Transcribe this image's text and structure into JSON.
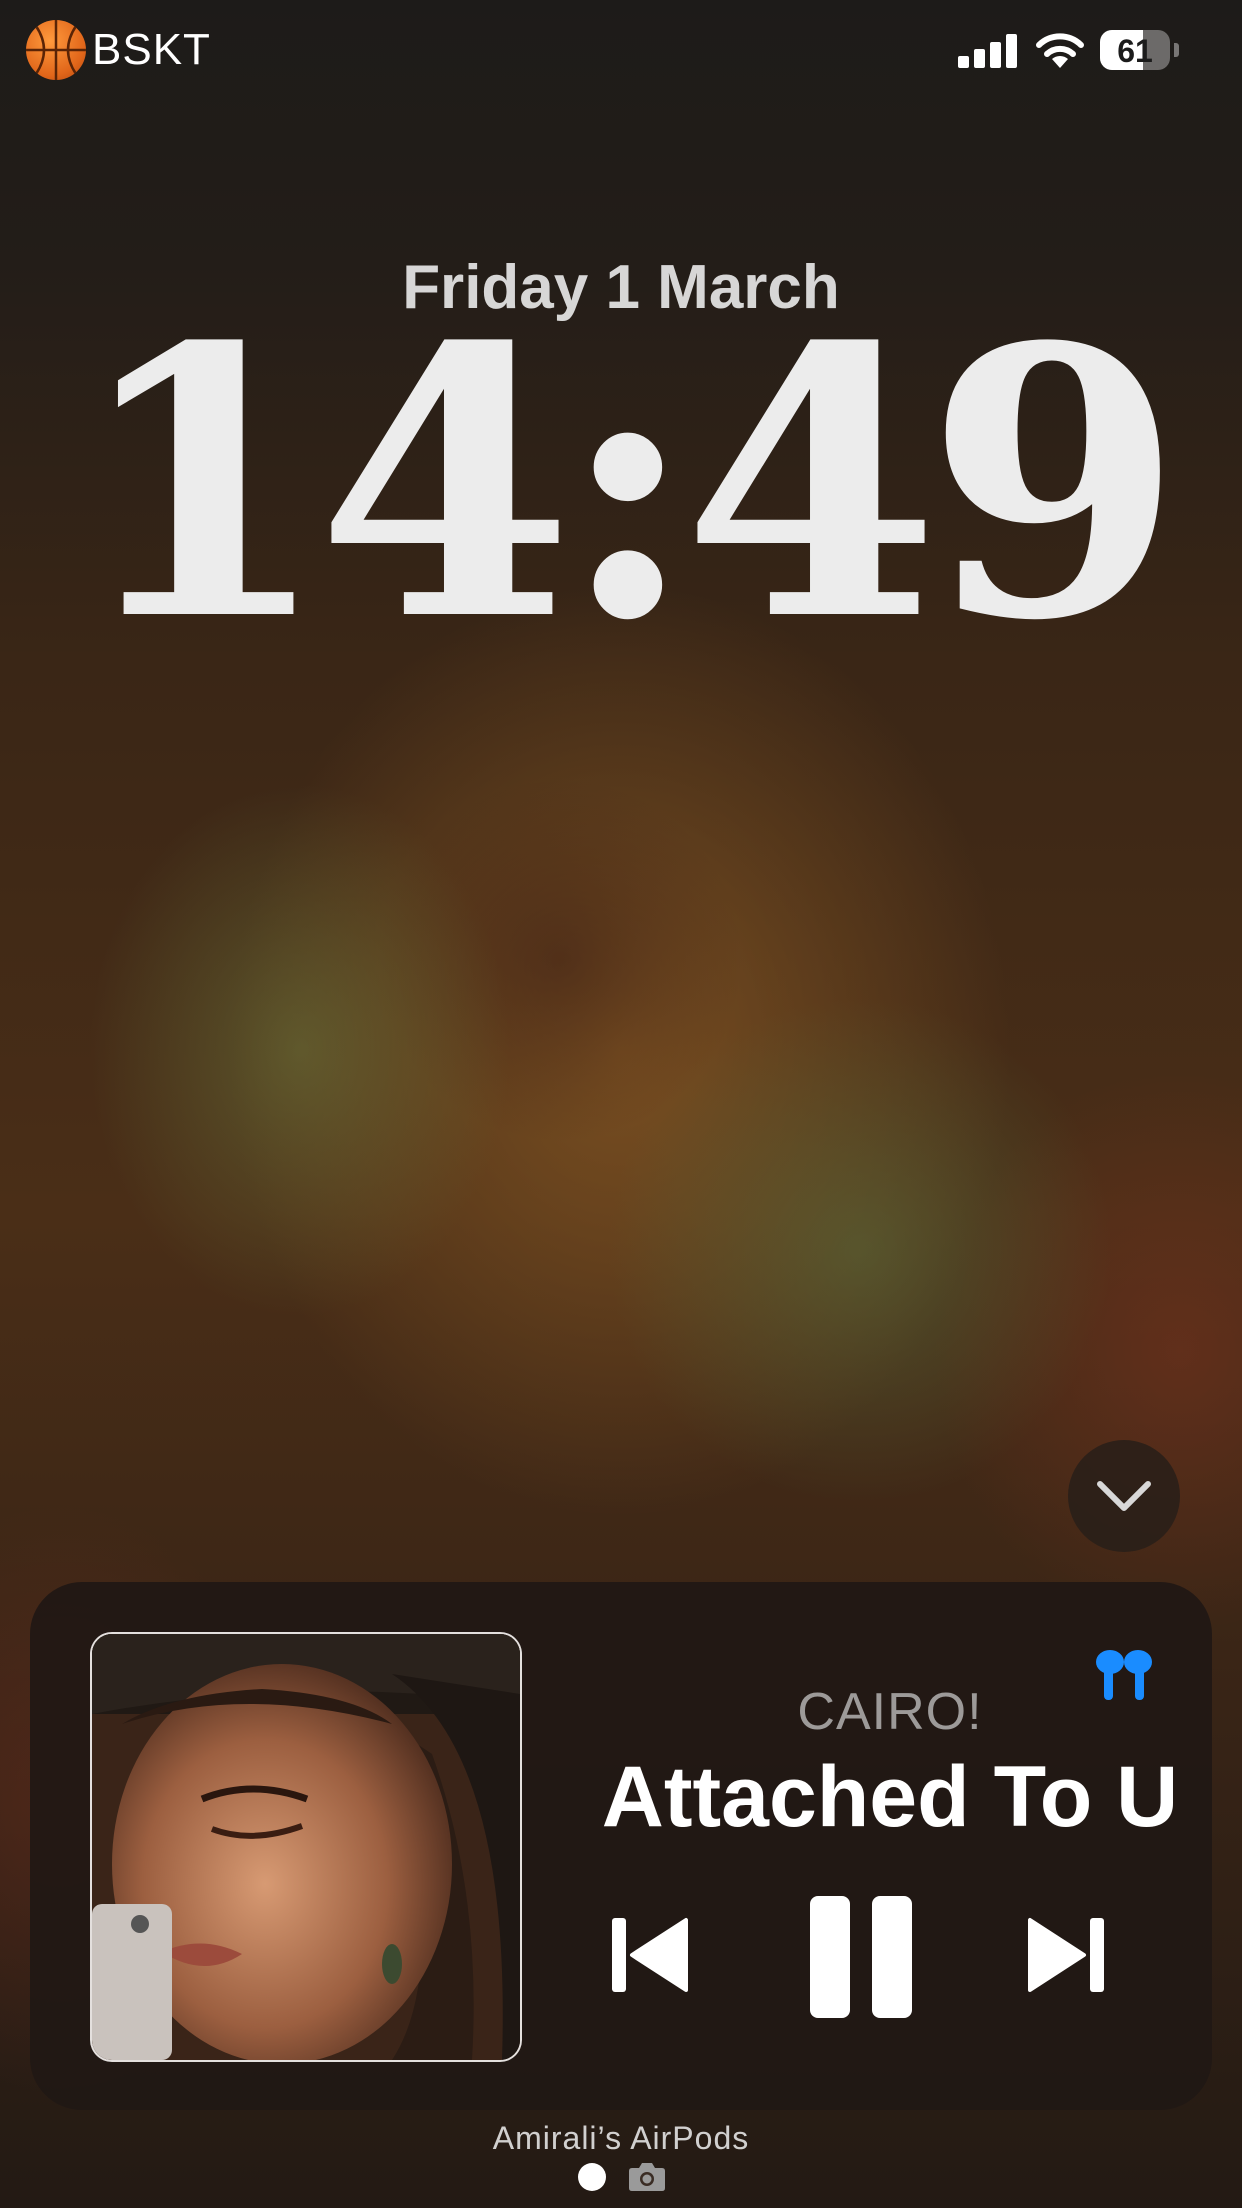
{
  "status_bar": {
    "app_icon": "basketball-icon",
    "app_label": "BSKT",
    "signal_icon": "cellular-signal-icon",
    "wifi_icon": "wifi-icon",
    "battery_percent": "61"
  },
  "lock_screen": {
    "date": "Friday 1 March",
    "time": "14:49"
  },
  "now_playing": {
    "collapse_icon": "chevron-down-icon",
    "output_icon": "airpods-icon",
    "artist": "CAIRO!",
    "title": "Attached To U",
    "controls": {
      "previous_icon": "previous-track-icon",
      "pause_icon": "pause-icon",
      "next_icon": "next-track-icon"
    },
    "output_device": "Amirali’s AirPods"
  },
  "pager": {
    "camera_icon": "camera-icon"
  },
  "colors": {
    "accent_blue": "#1a8cff",
    "text_primary": "#ffffff",
    "card_bg": "#201814"
  }
}
